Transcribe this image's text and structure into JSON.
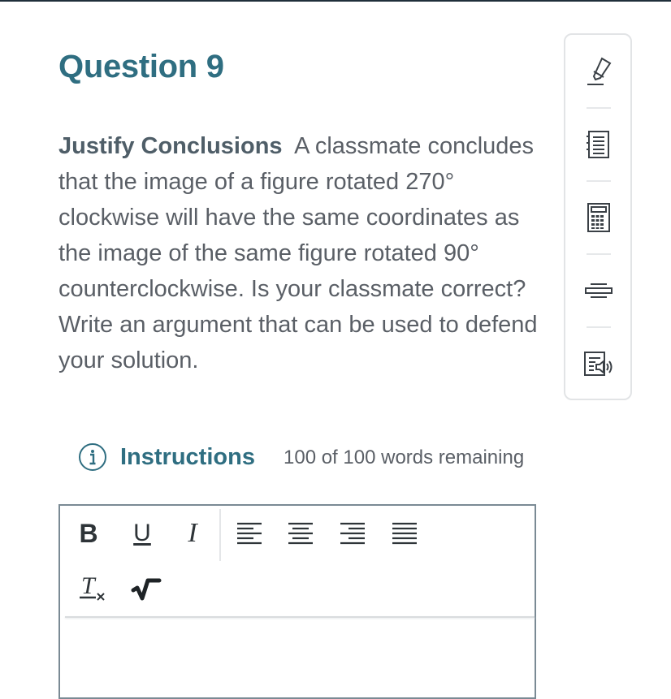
{
  "question": {
    "title": "Question 9",
    "lead": "Justify Conclusions",
    "body": "A classmate concludes that the image of a figure rotated 270° clockwise will have the same coordinates as the image of the same figure rotated 90° counterclockwise. Is your classmate correct? Write an argument that can be used to defend your solution."
  },
  "instructions": {
    "icon": "info-icon",
    "label": "Instructions",
    "word_count": "100 of 100 words remaining"
  },
  "editor": {
    "toolbar": {
      "bold_label": "B",
      "underline_label": "U",
      "italic_label": "I",
      "align_icons": [
        "align-left-icon",
        "align-center-icon",
        "align-right-icon",
        "align-justify-icon"
      ],
      "row2_icons": [
        "clear-format-icon",
        "math-sqrt-icon"
      ]
    },
    "content": ""
  },
  "tools_panel": {
    "icons": [
      "highlighter-icon",
      "notepad-icon",
      "calculator-icon",
      "line-reader-icon",
      "text-to-speech-icon"
    ]
  },
  "colors": {
    "accent": "#2f6e81",
    "body_text": "#5a5f66",
    "border": "#7a8a94",
    "icon": "#3a4046"
  }
}
